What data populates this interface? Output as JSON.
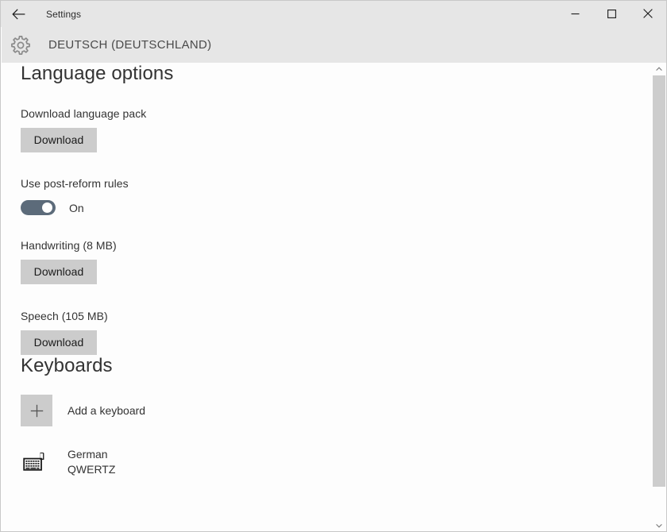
{
  "window": {
    "title": "Settings",
    "back_icon": "back-arrow-icon",
    "controls": {
      "minimize": "minimize-icon",
      "maximize": "maximize-icon",
      "close": "close-icon"
    }
  },
  "header": {
    "gear_icon": "gear-icon",
    "language": "DEUTSCH (DEUTSCHLAND)"
  },
  "language_options": {
    "heading": "Language options",
    "download_pack": {
      "label": "Download language pack",
      "button": "Download"
    },
    "post_reform": {
      "label": "Use post-reform rules",
      "state": "On",
      "toggle_on": true
    },
    "handwriting": {
      "label": "Handwriting (8 MB)",
      "button": "Download"
    },
    "speech": {
      "label": "Speech (105 MB)",
      "button": "Download"
    }
  },
  "keyboards": {
    "heading": "Keyboards",
    "add": {
      "icon": "plus-icon",
      "label": "Add a keyboard"
    },
    "items": [
      {
        "icon": "keyboard-icon",
        "name": "German",
        "layout": "QWERTZ"
      }
    ]
  },
  "scrollbar": {
    "up_icon": "scroll-up-arrow-icon",
    "down_icon": "scroll-down-arrow-icon"
  },
  "colors": {
    "titlebar_bg": "#e6e6e6",
    "content_bg": "#fdfdfd",
    "button_bg": "#cccccc",
    "toggle_on": "#5c6b7a",
    "text": "#333333",
    "scroll_thumb": "#cdcdcd"
  }
}
